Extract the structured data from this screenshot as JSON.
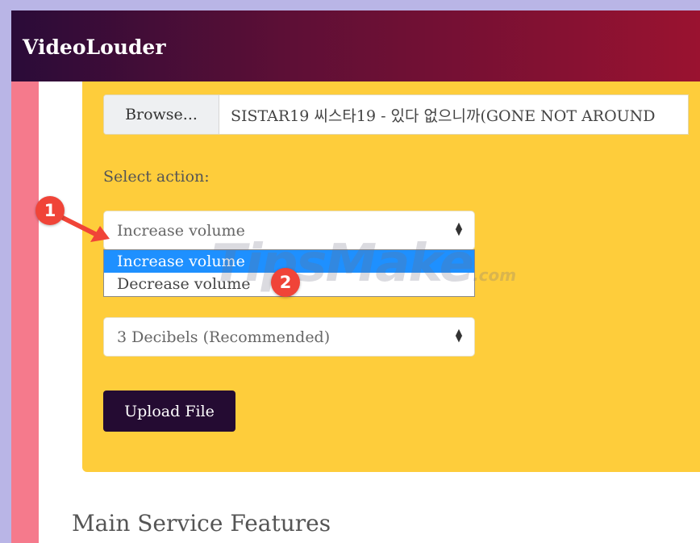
{
  "header": {
    "brand": "VideoLouder"
  },
  "file_input": {
    "browse_label": "Browse...",
    "file_name": "SISTAR19 씨스타19 - 있다 없으니까(GONE NOT AROUND"
  },
  "action": {
    "label": "Select action:",
    "selected": "Increase volume",
    "options": [
      "Increase volume",
      "Decrease volume"
    ]
  },
  "decibels": {
    "selected": "3 Decibels (Recommended)"
  },
  "upload": {
    "label": "Upload File"
  },
  "features": {
    "title": "Main Service Features"
  },
  "annotations": {
    "badge1": "1",
    "badge2": "2",
    "watermark": "TipsMake",
    "watermark_suffix": ".com"
  },
  "colors": {
    "header_start": "#2a0b38",
    "header_end": "#9a1230",
    "panel": "#fecd3b",
    "stripe": "#f57a8c",
    "button": "#240b32",
    "selected_option": "#1e90ff",
    "badge": "#f04438"
  }
}
